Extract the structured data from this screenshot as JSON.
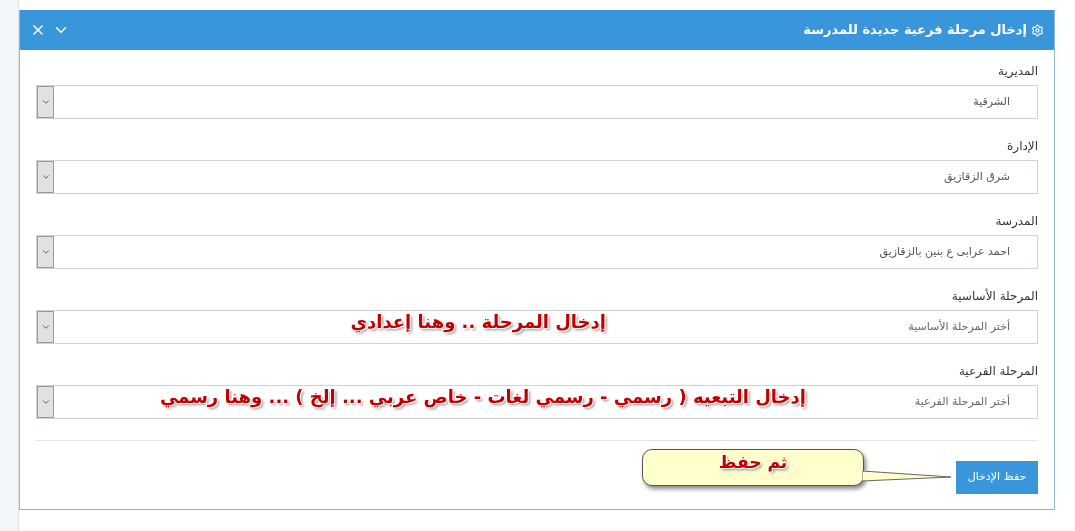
{
  "panel": {
    "title": "إدخال مرحلة فرعية جديدة للمدرسة"
  },
  "fields": [
    {
      "label": "المديرية",
      "value": "الشرقية"
    },
    {
      "label": "الإدارة",
      "value": "شرق الزقازيق"
    },
    {
      "label": "المدرسة",
      "value": "احمد عرابى ع بنين بالزقازيق"
    },
    {
      "label": "المرحلة الأساسية",
      "placeholder": "أختر المرحلة الأساسية",
      "annotation": "إدخال المرحلة .. وهنا إعدادي"
    },
    {
      "label": "المرحلة الفرعية",
      "placeholder": "أختر المرحلة الفرعية",
      "annotation": "إدخال التبعيه ( رسمي - رسمي لغات - خاص عربي ... إلخ )  ... وهنا  رسمي"
    }
  ],
  "callout": "ثم حفظ",
  "save_button": "حفظ الإدخال"
}
